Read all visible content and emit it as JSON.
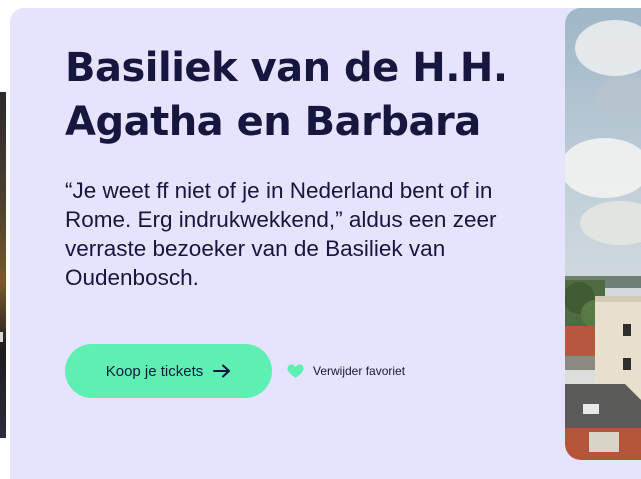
{
  "card": {
    "title": "Basiliek van de H.H. Agatha en Barbara",
    "quote": "“Je weet ff niet of je in Nederland bent of in Rome. Erg indrukwekkend,” aldus een zeer verraste bezoeker van de Basiliek van Oudenbosch.",
    "cta_label": "Koop je tickets",
    "cta_icon": "arrow-right-icon",
    "favorite_label": "Verwijder favoriet",
    "favorite_icon": "heart-icon"
  },
  "colors": {
    "card_bg": "#e5e3fe",
    "text": "#16163f",
    "accent": "#5ef0b2"
  }
}
